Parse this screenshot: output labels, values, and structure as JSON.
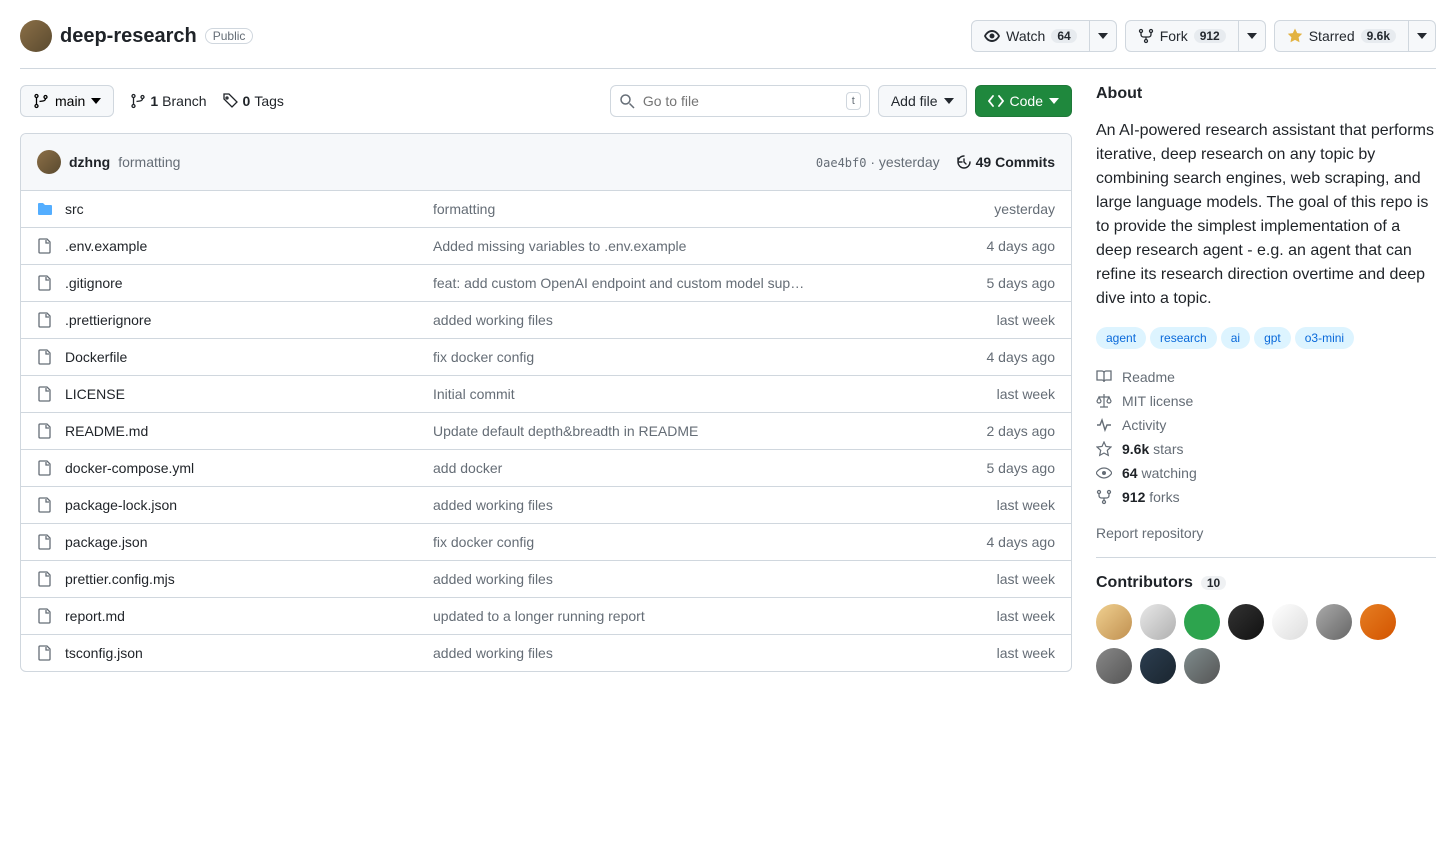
{
  "header": {
    "repo_name": "deep-research",
    "visibility": "Public",
    "watch": {
      "label": "Watch",
      "count": "64"
    },
    "fork": {
      "label": "Fork",
      "count": "912"
    },
    "star": {
      "label": "Starred",
      "count": "9.6k"
    }
  },
  "toolbar": {
    "branch": "main",
    "branches_count": "1",
    "branches_label": "Branch",
    "tags_count": "0",
    "tags_label": "Tags",
    "search_placeholder": "Go to file",
    "search_kbd": "t",
    "addfile": "Add file",
    "code": "Code"
  },
  "commit": {
    "author": "dzhng",
    "message": "formatting",
    "sha": "0ae4bf0",
    "age": "yesterday",
    "commits_count": "49",
    "commits_label": "Commits"
  },
  "files": [
    {
      "type": "dir",
      "name": "src",
      "message": "formatting",
      "age": "yesterday"
    },
    {
      "type": "file",
      "name": ".env.example",
      "message": "Added missing variables to .env.example",
      "age": "4 days ago"
    },
    {
      "type": "file",
      "name": ".gitignore",
      "message": "feat: add custom OpenAI endpoint and custom model sup…",
      "age": "5 days ago"
    },
    {
      "type": "file",
      "name": ".prettierignore",
      "message": "added working files",
      "age": "last week"
    },
    {
      "type": "file",
      "name": "Dockerfile",
      "message": "fix docker config",
      "age": "4 days ago"
    },
    {
      "type": "file",
      "name": "LICENSE",
      "message": "Initial commit",
      "age": "last week"
    },
    {
      "type": "file",
      "name": "README.md",
      "message": "Update default depth&breadth in README",
      "age": "2 days ago"
    },
    {
      "type": "file",
      "name": "docker-compose.yml",
      "message": "add docker",
      "age": "5 days ago"
    },
    {
      "type": "file",
      "name": "package-lock.json",
      "message": "added working files",
      "age": "last week"
    },
    {
      "type": "file",
      "name": "package.json",
      "message": "fix docker config",
      "age": "4 days ago"
    },
    {
      "type": "file",
      "name": "prettier.config.mjs",
      "message": "added working files",
      "age": "last week"
    },
    {
      "type": "file",
      "name": "report.md",
      "message": "updated to a longer running report",
      "age": "last week"
    },
    {
      "type": "file",
      "name": "tsconfig.json",
      "message": "added working files",
      "age": "last week"
    }
  ],
  "about": {
    "heading": "About",
    "description": "An AI-powered research assistant that performs iterative, deep research on any topic by combining search engines, web scraping, and large language models. The goal of this repo is to provide the simplest implementation of a deep research agent - e.g. an agent that can refine its research direction overtime and deep dive into a topic.",
    "topics": [
      "agent",
      "research",
      "ai",
      "gpt",
      "o3-mini"
    ],
    "readme": "Readme",
    "license": "MIT license",
    "activity": "Activity",
    "stars_count": "9.6k",
    "stars_label": "stars",
    "watching_count": "64",
    "watching_label": "watching",
    "forks_count": "912",
    "forks_label": "forks",
    "report": "Report repository"
  },
  "contributors": {
    "heading": "Contributors",
    "count": "10"
  }
}
